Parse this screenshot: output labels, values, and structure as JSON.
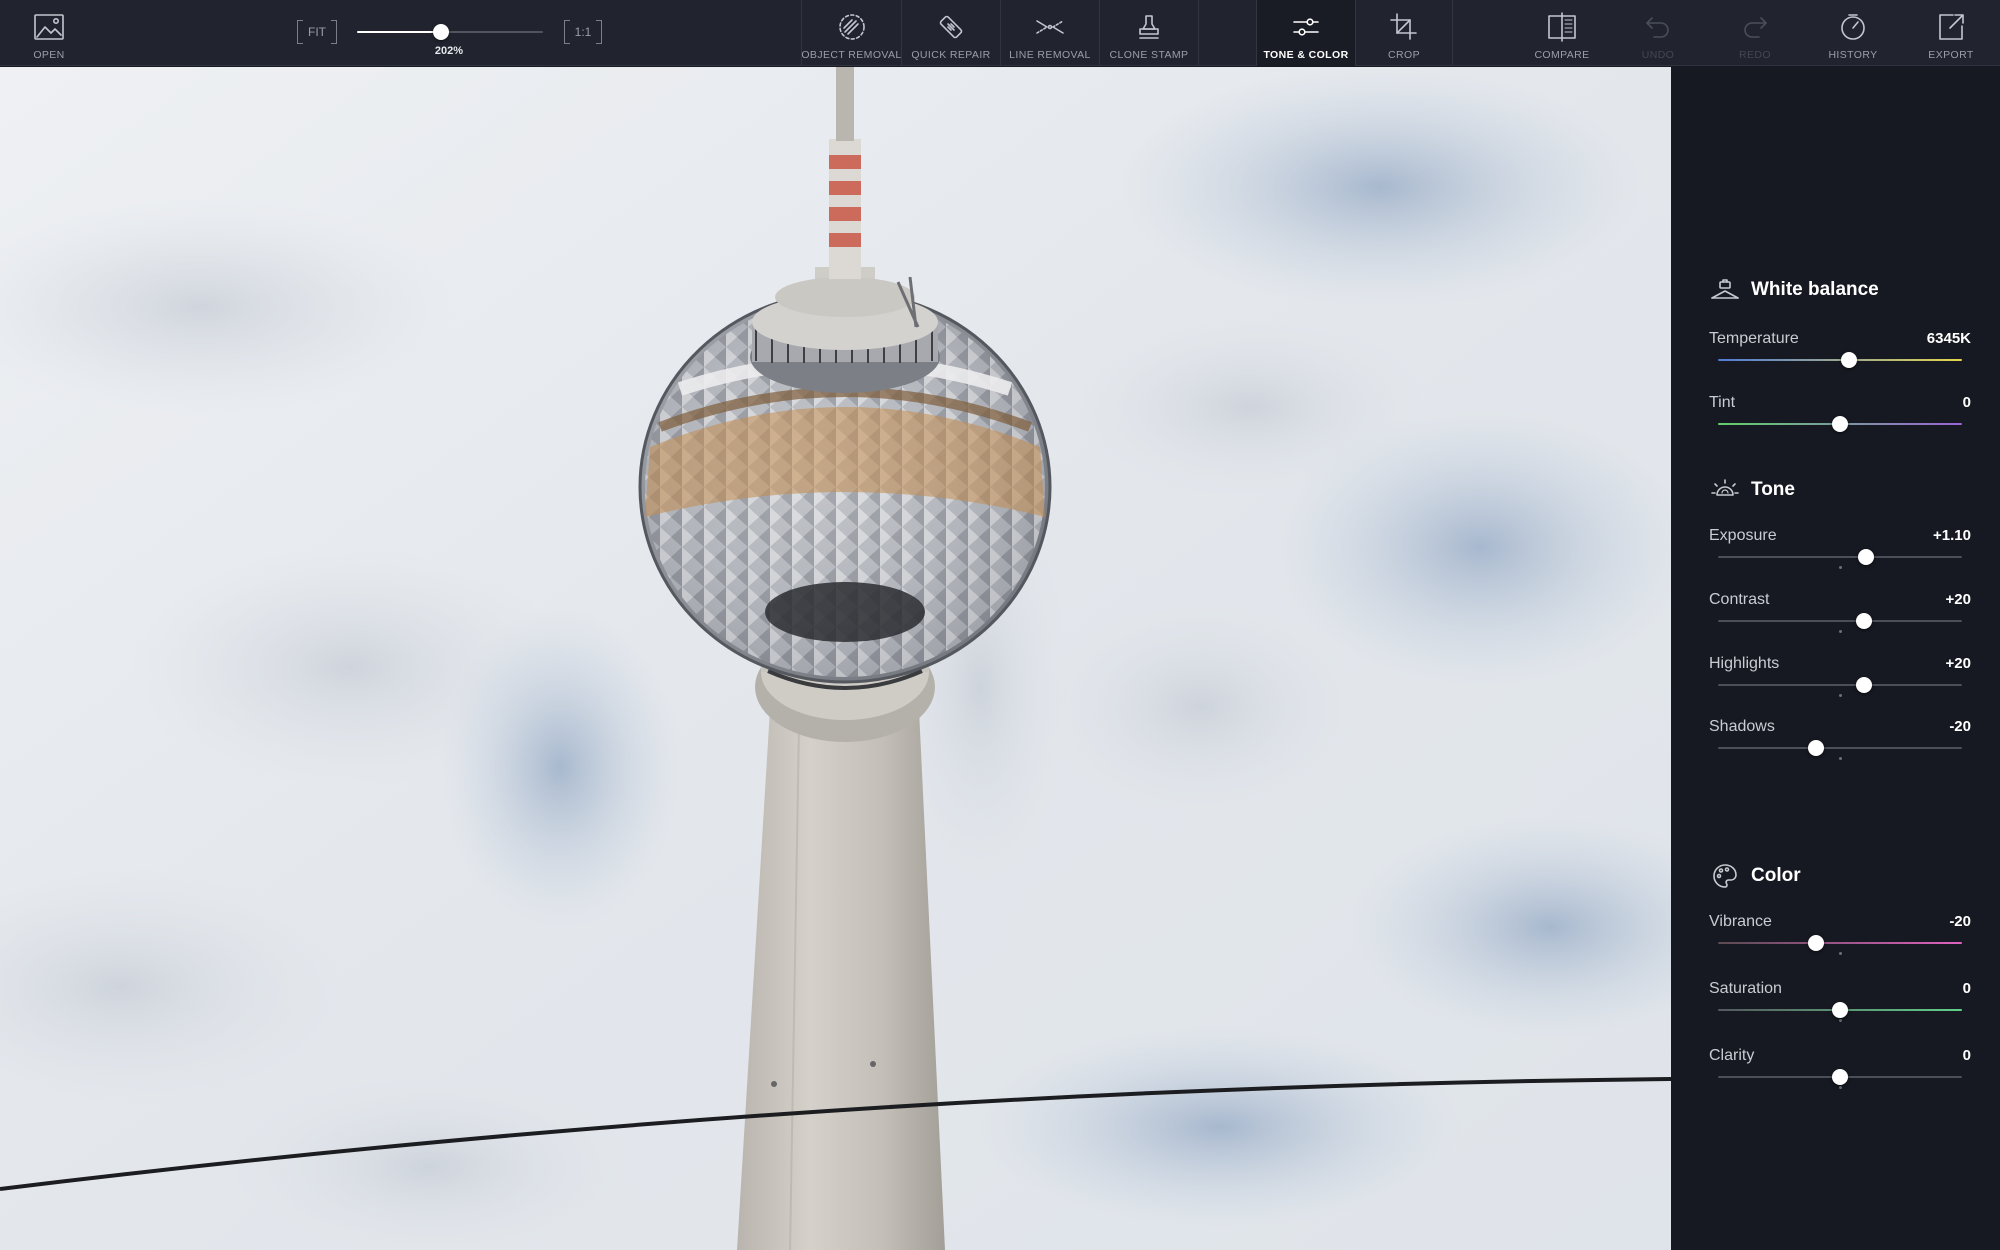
{
  "toolbar": {
    "open": {
      "label": "OPEN",
      "icon": "image-icon"
    },
    "zoom": {
      "fit_label": "FIT",
      "one_to_one_label": "1:1",
      "value_label": "202%",
      "slider_fraction": 0.45
    },
    "tools": [
      {
        "label": "OBJECT REMOVAL",
        "icon": "object-removal-icon"
      },
      {
        "label": "QUICK REPAIR",
        "icon": "bandage-icon"
      },
      {
        "label": "LINE REMOVAL",
        "icon": "line-removal-icon"
      },
      {
        "label": "CLONE STAMP",
        "icon": "stamp-icon"
      },
      {
        "label": "TONE & COLOR",
        "icon": "sliders-icon",
        "active": true
      },
      {
        "label": "CROP",
        "icon": "crop-icon"
      }
    ],
    "actions": [
      {
        "label": "COMPARE",
        "icon": "compare-icon"
      },
      {
        "label": "UNDO",
        "icon": "undo-icon",
        "disabled": true
      },
      {
        "label": "REDO",
        "icon": "redo-icon",
        "disabled": true
      },
      {
        "label": "HISTORY",
        "icon": "history-icon"
      },
      {
        "label": "EXPORT",
        "icon": "export-icon"
      }
    ]
  },
  "panel": {
    "white_balance": {
      "title": "White balance",
      "icon": "white-balance-icon",
      "temperature": {
        "label": "Temperature",
        "value": "6345K",
        "fraction": 0.535,
        "gradient": [
          "#4f7bd6",
          "#e6d54c"
        ]
      },
      "tint": {
        "label": "Tint",
        "value": "0",
        "fraction": 0.5,
        "gradient": [
          "#5fd06a",
          "#9a63d2"
        ]
      }
    },
    "tone": {
      "title": "Tone",
      "icon": "sun-icon",
      "exposure": {
        "label": "Exposure",
        "value": "+1.10",
        "fraction": 0.605
      },
      "contrast": {
        "label": "Contrast",
        "value": "+20",
        "fraction": 0.6
      },
      "highlights": {
        "label": "Highlights",
        "value": "+20",
        "fraction": 0.6
      },
      "shadows": {
        "label": "Shadows",
        "value": "-20",
        "fraction": 0.4
      }
    },
    "color": {
      "title": "Color",
      "icon": "palette-icon",
      "vibrance": {
        "label": "Vibrance",
        "value": "-20",
        "fraction": 0.4,
        "gradient": [
          "#5a4a52",
          "#e060c0"
        ]
      },
      "saturation": {
        "label": "Saturation",
        "value": "0",
        "fraction": 0.5,
        "gradient": [
          "#55595f",
          "#5fd088"
        ]
      },
      "clarity": {
        "label": "Clarity",
        "value": "0",
        "fraction": 0.5
      }
    }
  },
  "colors": {
    "toolbar_bg": "#21242e",
    "panel_bg": "#161921",
    "accent": "#ffffff"
  }
}
